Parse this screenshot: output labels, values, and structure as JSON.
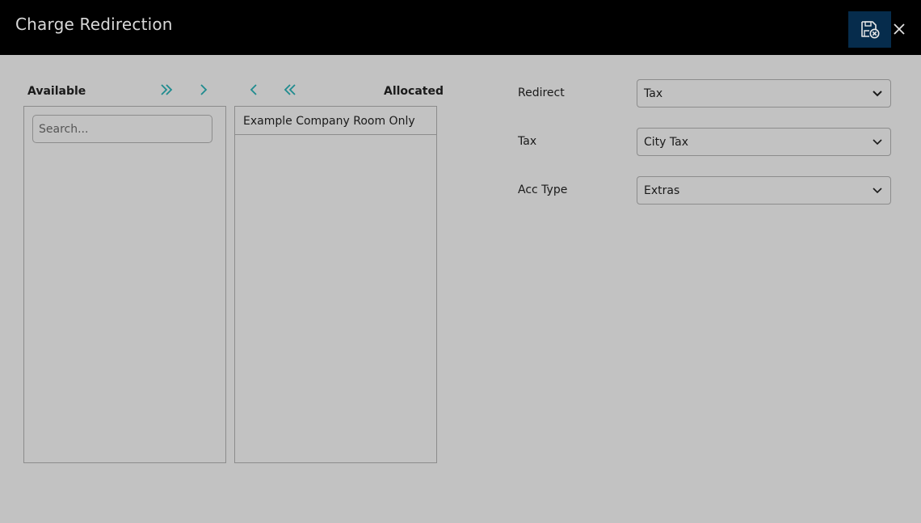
{
  "window": {
    "title": "Charge Redirection"
  },
  "icons": {
    "save": "save-cancel-icon",
    "close": "close-icon",
    "move_all_right": "double-chevron-right-icon",
    "move_right": "chevron-right-icon",
    "move_left": "chevron-left-icon",
    "move_all_left": "double-chevron-left-icon"
  },
  "colors": {
    "header_bg": "#000000",
    "save_button_bg": "#062c4c",
    "body_bg": "#c2c2c2",
    "accent_arrows": "#1e8b8f"
  },
  "available": {
    "label": "Available",
    "search_placeholder": "Search...",
    "items": []
  },
  "allocated": {
    "label": "Allocated",
    "items": [
      "Example Company Room Only"
    ]
  },
  "form": {
    "redirect": {
      "label": "Redirect",
      "value": "Tax"
    },
    "tax": {
      "label": "Tax",
      "value": "City Tax"
    },
    "acc_type": {
      "label": "Acc Type",
      "value": "Extras"
    }
  }
}
